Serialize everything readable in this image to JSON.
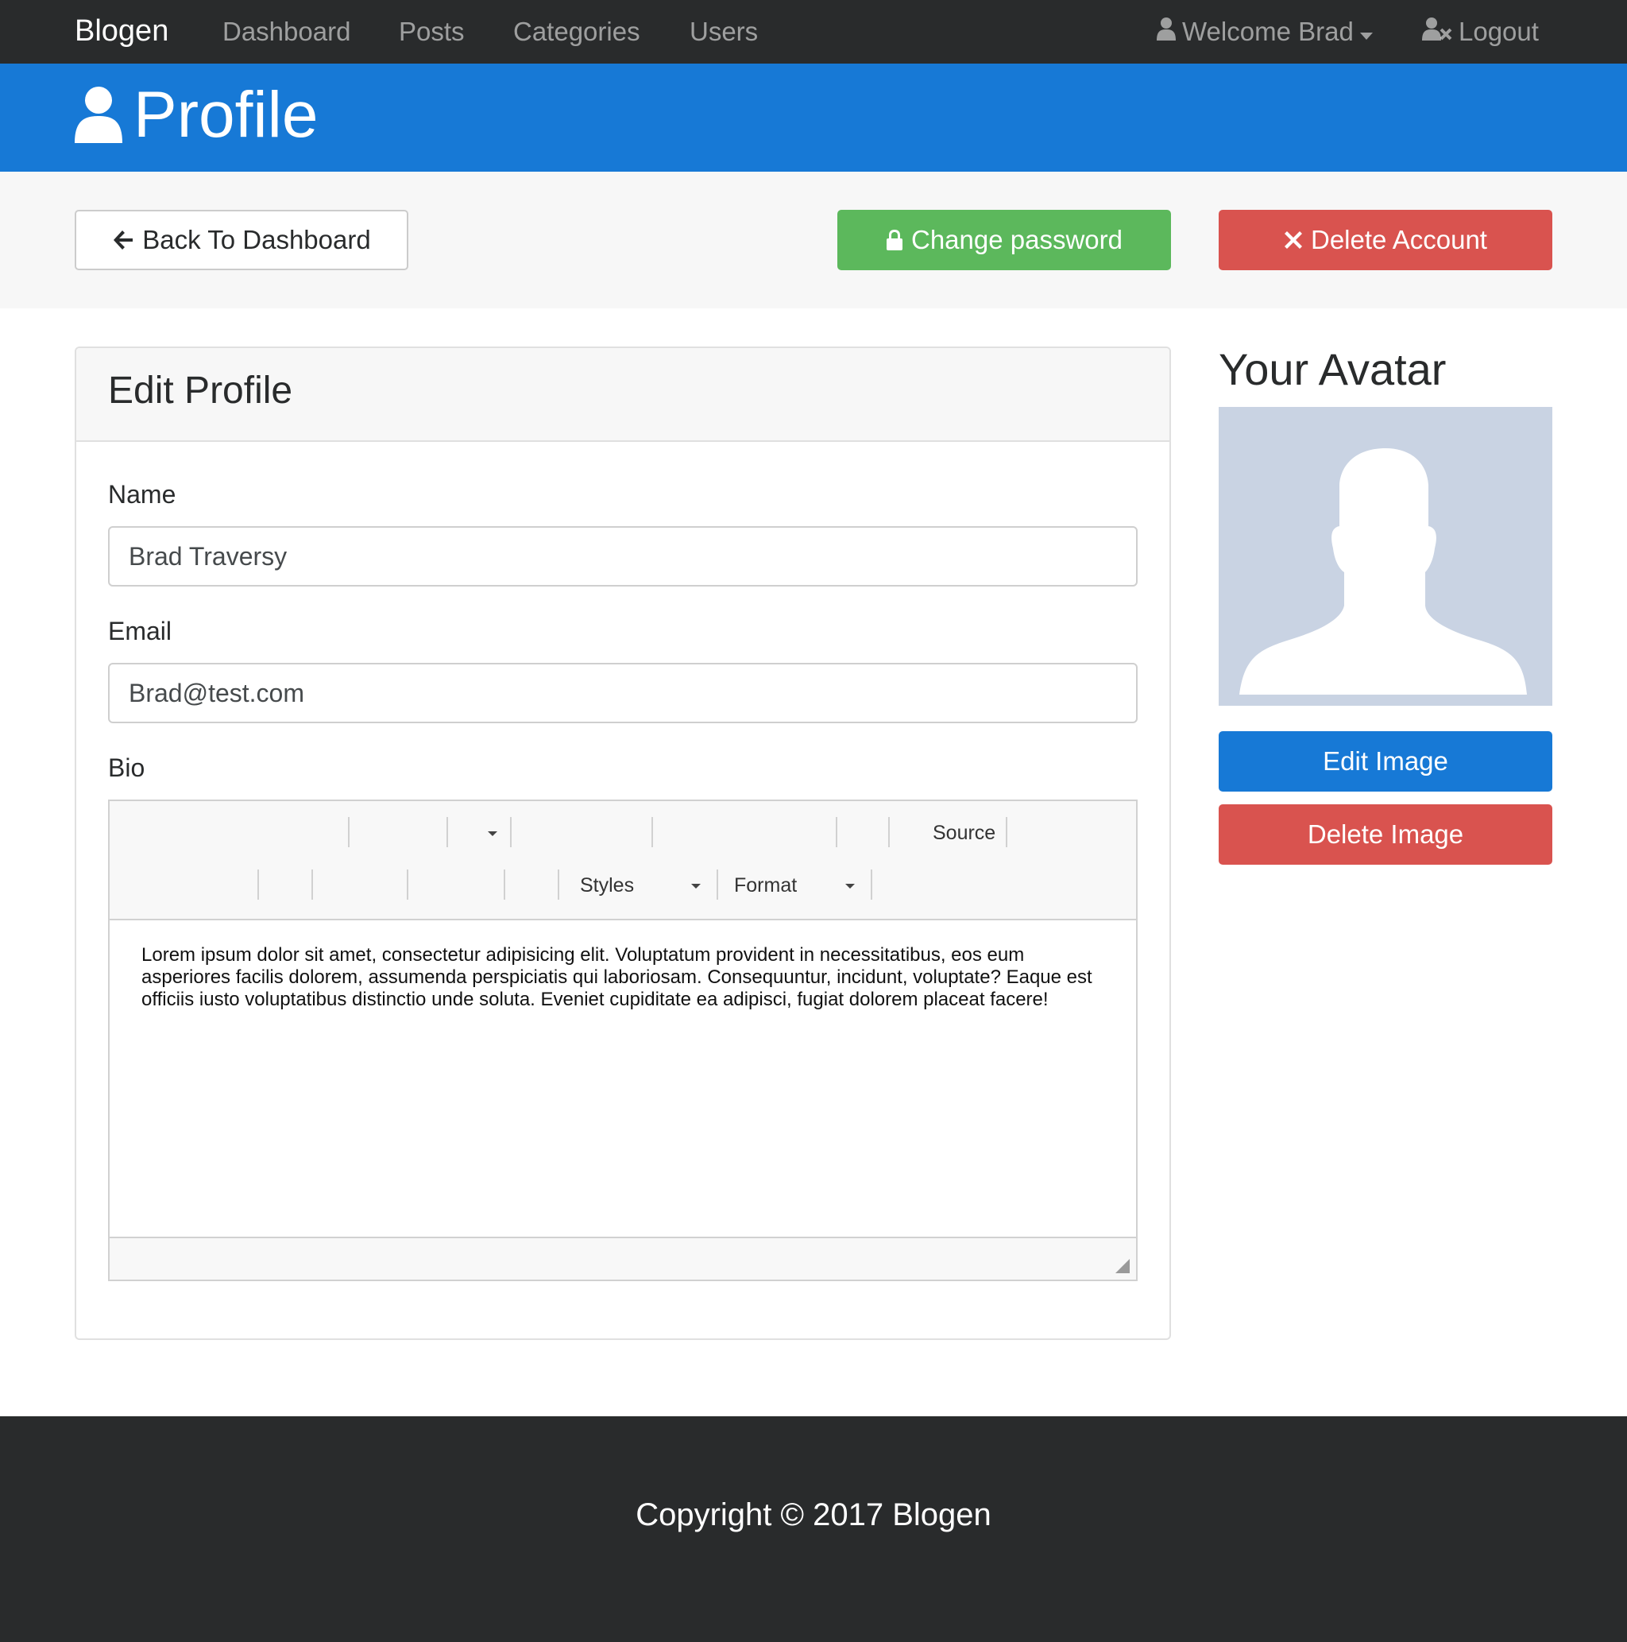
{
  "navbar": {
    "brand": "Blogen",
    "links": [
      "Dashboard",
      "Posts",
      "Categories",
      "Users"
    ],
    "welcome": "Welcome Brad",
    "logout": "Logout"
  },
  "header": {
    "title": "Profile"
  },
  "actions": {
    "back_label": "Back To Dashboard",
    "change_password_label": "Change password",
    "delete_account_label": "Delete Account"
  },
  "edit_profile": {
    "title": "Edit Profile",
    "name_label": "Name",
    "name_value": "Brad Traversy",
    "email_label": "Email",
    "email_value": "Brad@test.com",
    "bio_label": "Bio",
    "editor": {
      "source_label": "Source",
      "styles_label": "Styles",
      "format_label": "Format",
      "content": "Lorem ipsum dolor sit amet, consectetur adipisicing elit. Voluptatum provident in necessitatibus, eos eum asperiores facilis dolorem, assumenda perspiciatis qui laboriosam. Consequuntur, incidunt, voluptate? Eaque est officiis iusto voluptatibus distinctio unde soluta. Eveniet cupiditate ea adipisci, fugiat dolorem placeat facere!"
    }
  },
  "avatar": {
    "title": "Your Avatar",
    "edit_label": "Edit Image",
    "delete_label": "Delete Image"
  },
  "footer": {
    "copyright": "Copyright © 2017 Blogen"
  },
  "colors": {
    "navbar": "#292b2c",
    "primary": "#1779d6",
    "success": "#5cb85c",
    "danger": "#d9534f",
    "avatar_bg": "#c9d3e3"
  },
  "icons": {
    "header": "user-icon",
    "back": "arrow-left-icon",
    "password": "lock-icon",
    "delete": "close-icon",
    "welcome": "user-icon",
    "logout": "user-times-icon"
  }
}
